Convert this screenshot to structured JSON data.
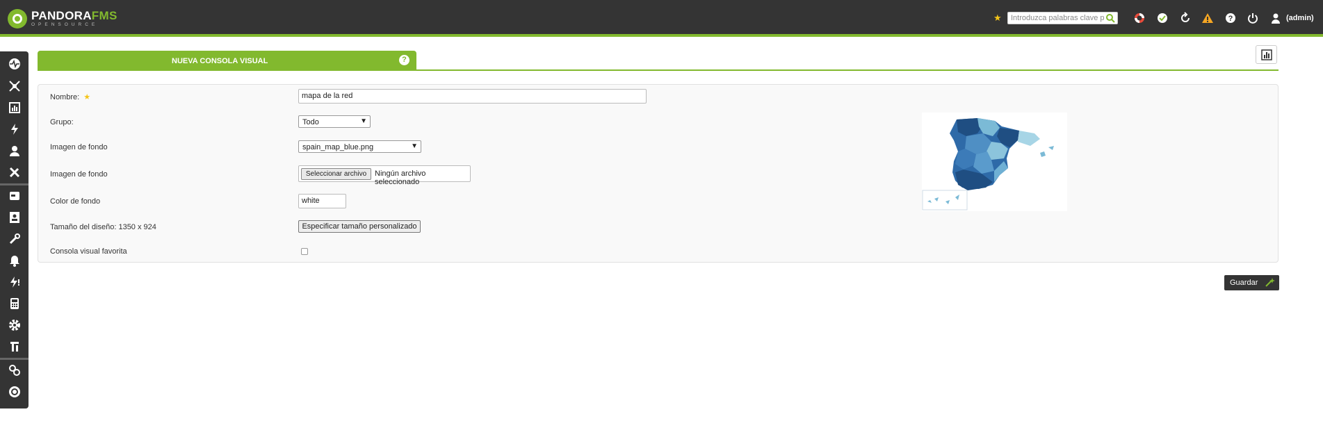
{
  "app": {
    "logo_main": "PANDORA",
    "logo_accent": "FMS",
    "logo_sub": "OPENSOURCE"
  },
  "topbar": {
    "search_placeholder": "Introduzca palabras clave p",
    "user_label": "(admin)",
    "icons": [
      "star-icon",
      "search-icon",
      "lifebuoy-icon",
      "check-icon",
      "refresh-icon",
      "warning-icon",
      "help-icon",
      "power-icon",
      "user-icon"
    ]
  },
  "sidebar": {
    "icons": [
      "monitoring-icon",
      "topology-icon",
      "reporting-icon",
      "events-icon",
      "users-icon",
      "tools-icon",
      "servers-icon",
      "profile-icon",
      "setup-icon",
      "alerts-icon",
      "bolt-alert-icon",
      "calculator-icon",
      "gear-icon",
      "extensions-icon",
      "links-icon",
      "pandora-icon"
    ]
  },
  "header": {
    "title": "NUEVA CONSOLA VISUAL",
    "help": "?"
  },
  "form": {
    "name_label": "Nombre:",
    "name_value": "mapa de la red",
    "group_label": "Grupo:",
    "group_value": "Todo",
    "bg_image_label": "Imagen de fondo",
    "bg_image_value": "spain_map_blue.png",
    "bg_upload_label": "Imagen de fondo",
    "file_button": "Seleccionar archivo",
    "file_status": "Ningún archivo seleccionado",
    "bg_color_label": "Color de fondo",
    "bg_color_value": "white",
    "size_label": "Tamaño del diseño: 1350 x 924",
    "size_button": "Especificar tamaño personalizado",
    "favorite_label": "Consola visual favorita"
  },
  "actions": {
    "save_label": "Guardar"
  },
  "colors": {
    "accent": "#82b92e",
    "topbar": "#343434"
  }
}
